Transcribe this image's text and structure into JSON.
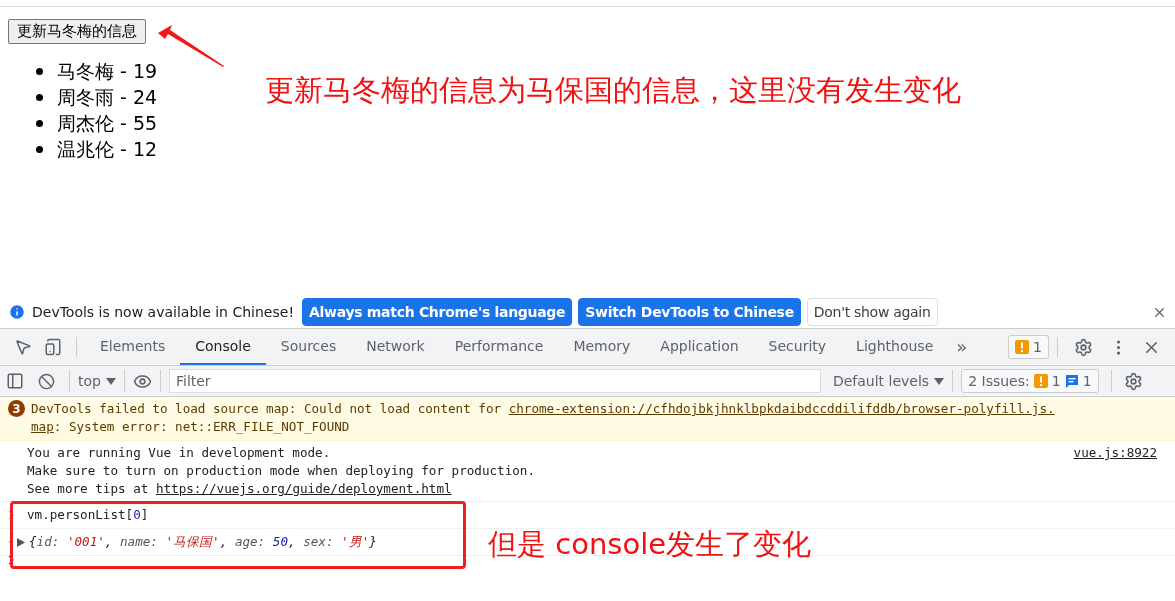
{
  "page": {
    "button": "更新马冬梅的信息",
    "persons": [
      {
        "text": "马冬梅 - 19"
      },
      {
        "text": "周冬雨 - 24"
      },
      {
        "text": "周杰伦 - 55"
      },
      {
        "text": "温兆伦 - 12"
      }
    ],
    "annotation": "更新马冬梅的信息为马保国的信息，这里没有发生变化"
  },
  "devtools": {
    "infobar": {
      "message": "DevTools is now available in Chinese!",
      "buttons": [
        {
          "label": "Always match Chrome's language",
          "kind": "primary"
        },
        {
          "label": "Switch DevTools to Chinese",
          "kind": "primary"
        },
        {
          "label": "Don't show again",
          "kind": "secondary"
        }
      ]
    },
    "tabs": [
      {
        "label": "Elements",
        "selected": false
      },
      {
        "label": "Console",
        "selected": true
      },
      {
        "label": "Sources",
        "selected": false
      },
      {
        "label": "Network",
        "selected": false
      },
      {
        "label": "Performance",
        "selected": false
      },
      {
        "label": "Memory",
        "selected": false
      },
      {
        "label": "Application",
        "selected": false
      },
      {
        "label": "Security",
        "selected": false
      },
      {
        "label": "Lighthouse",
        "selected": false
      }
    ],
    "more_tabs": "»",
    "warning_badge": "1",
    "toolbar": {
      "context": "top",
      "filter_placeholder": "Filter",
      "levels": "Default levels",
      "issues_label": "2 Issues:",
      "issues_warnings": "1",
      "issues_info": "1"
    },
    "messages": [
      {
        "kind": "warning",
        "count": "3",
        "text": "DevTools failed to load source map: Could not load content for ",
        "link_parts": [
          "chrome-extension://cfhdojbkjhnklbpkdaibdccddilifddb/browser-polyfill.js.",
          "map"
        ],
        "text_after": ": System error: net::ERR_FILE_NOT_FOUND"
      },
      {
        "kind": "log",
        "lines": [
          "You are running Vue in development mode.",
          "Make sure to turn on production mode when deploying for production."
        ],
        "tips_text": "See more tips at ",
        "tips_link": "https://vuejs.org/guide/deployment.html",
        "source": "vue.js:8922"
      },
      {
        "kind": "input",
        "tokens": [
          {
            "kind": "plain",
            "text": "vm.personList["
          },
          {
            "kind": "number",
            "text": "0"
          },
          {
            "kind": "plain",
            "text": "]"
          }
        ]
      },
      {
        "kind": "result",
        "tokens": [
          {
            "kind": "punct",
            "text": "{"
          },
          {
            "kind": "key",
            "text": "id: "
          },
          {
            "kind": "string",
            "text": "'001'"
          },
          {
            "kind": "punct",
            "text": ", "
          },
          {
            "kind": "key",
            "text": "name: "
          },
          {
            "kind": "string",
            "text": "'马保国'"
          },
          {
            "kind": "punct",
            "text": ", "
          },
          {
            "kind": "key",
            "text": "age: "
          },
          {
            "kind": "number",
            "text": "50"
          },
          {
            "kind": "punct",
            "text": ", "
          },
          {
            "kind": "key",
            "text": "sex: "
          },
          {
            "kind": "string",
            "text": "'男'"
          },
          {
            "kind": "punct",
            "text": "}"
          }
        ]
      }
    ],
    "annotation": "但是 console发生了变化"
  }
}
